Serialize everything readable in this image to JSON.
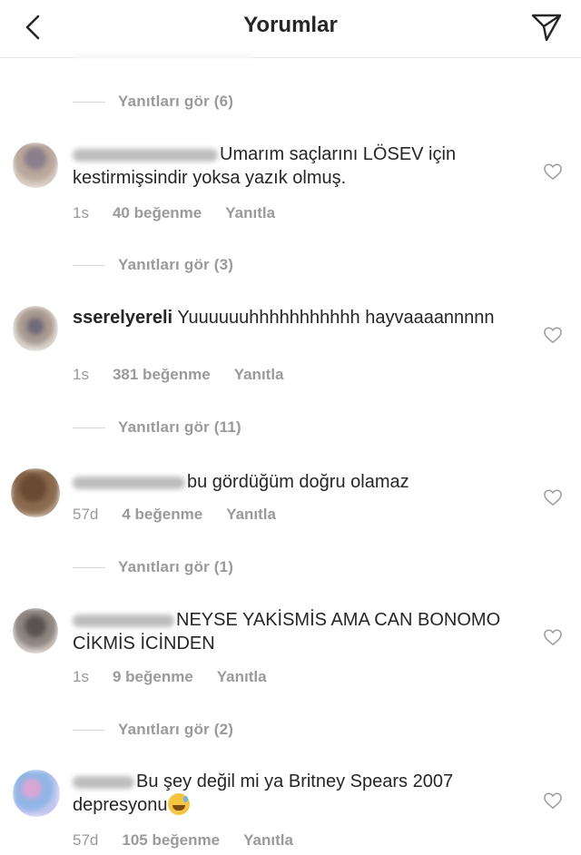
{
  "header": {
    "title": "Yorumlar"
  },
  "icons": {
    "back": "chevron-left-icon",
    "send": "paper-plane-icon",
    "like": "heart-icon"
  },
  "view_replies": [
    {
      "label": "Yanıtları gör (6)"
    },
    {
      "label": "Yanıtları gör (3)"
    },
    {
      "label": "Yanıtları gör (11)"
    },
    {
      "label": "Yanıtları gör (1)"
    },
    {
      "label": "Yanıtları gör (2)"
    }
  ],
  "comments": [
    {
      "username": "",
      "text": "Umarım saçlarını LÖSEV için kestirmişsindir yoksa yazık olmuş.",
      "time": "1s",
      "likes": "40 beğenme",
      "reply": "Yanıtla"
    },
    {
      "username": "sserelyereli",
      "text": "Yuuuuuuhhhhhhhhhhh hayvaaaannnnn",
      "time": "1s",
      "likes": "381 beğenme",
      "reply": "Yanıtla"
    },
    {
      "username": "",
      "text": "bu gördüğüm doğru olamaz",
      "time": "57d",
      "likes": "4 beğenme",
      "reply": "Yanıtla"
    },
    {
      "username": "",
      "text": "NEYSE YAKİSMİS AMA CAN BONOMO CİKMİS İCİNDEN",
      "time": "1s",
      "likes": "9 beğenme",
      "reply": "Yanıtla"
    },
    {
      "username": "",
      "text": "Bu şey değil mi ya Britney Spears 2007 depresyonu",
      "time": "57d",
      "likes": "105 beğenme",
      "reply": "Yanıtla"
    }
  ]
}
